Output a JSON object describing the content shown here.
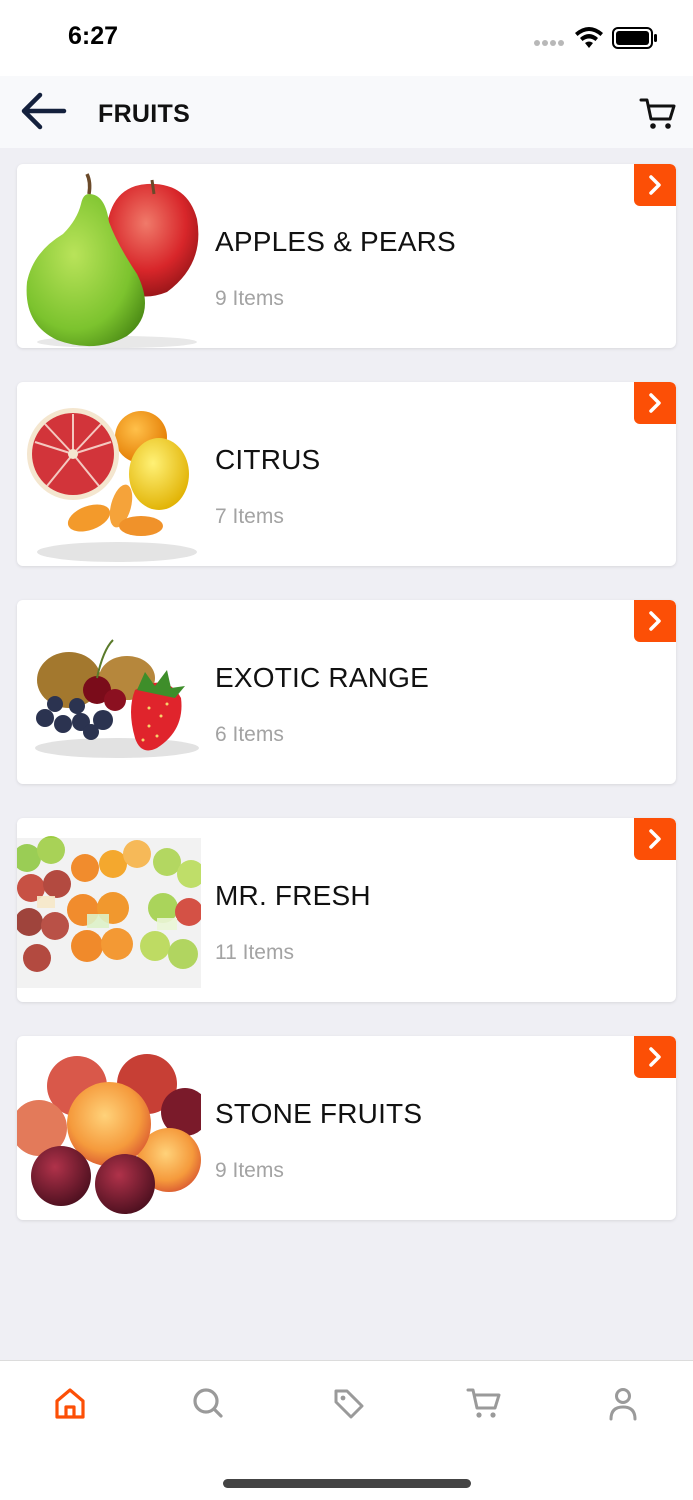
{
  "status": {
    "time": "6:27"
  },
  "header": {
    "title": "FRUITS",
    "back_icon": "arrow-left-icon",
    "cart_icon": "cart-icon"
  },
  "categories": [
    {
      "name": "APPLES & PEARS",
      "count": "9 Items",
      "image": "apple-and-pear"
    },
    {
      "name": "CITRUS",
      "count": "7 Items",
      "image": "citrus-fruits"
    },
    {
      "name": "EXOTIC RANGE",
      "count": "6 Items",
      "image": "exotic-fruits"
    },
    {
      "name": "MR. FRESH",
      "count": "11 Items",
      "image": "packaged-fruit"
    },
    {
      "name": "STONE FRUITS",
      "count": "9 Items",
      "image": "peaches-and-plums"
    }
  ],
  "tabs": [
    {
      "icon": "home-icon",
      "active": true
    },
    {
      "icon": "search-icon",
      "active": false
    },
    {
      "icon": "tag-icon",
      "active": false
    },
    {
      "icon": "cart-icon",
      "active": false
    },
    {
      "icon": "user-icon",
      "active": false
    }
  ],
  "colors": {
    "accent": "#fc4f06",
    "background": "#efeff4",
    "header_text": "#111111",
    "muted_text": "#a3a3a3",
    "tab_inactive": "#9a9a9a",
    "back_arrow": "#14213d"
  }
}
